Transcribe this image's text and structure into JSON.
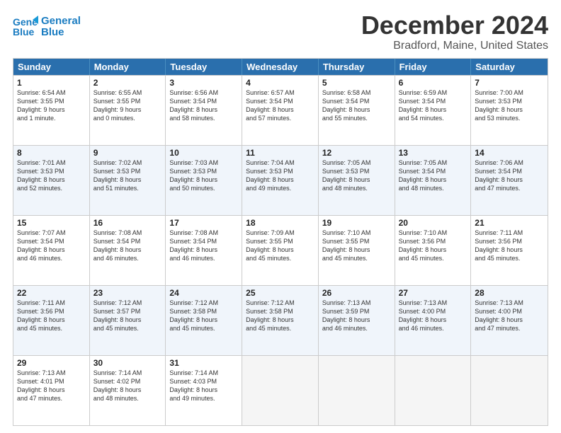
{
  "header": {
    "logo_line1": "General",
    "logo_line2": "Blue",
    "title": "December 2024",
    "subtitle": "Bradford, Maine, United States"
  },
  "calendar": {
    "weekdays": [
      "Sunday",
      "Monday",
      "Tuesday",
      "Wednesday",
      "Thursday",
      "Friday",
      "Saturday"
    ],
    "rows": [
      [
        {
          "day": "1",
          "lines": [
            "Sunrise: 6:54 AM",
            "Sunset: 3:55 PM",
            "Daylight: 9 hours",
            "and 1 minute."
          ]
        },
        {
          "day": "2",
          "lines": [
            "Sunrise: 6:55 AM",
            "Sunset: 3:55 PM",
            "Daylight: 9 hours",
            "and 0 minutes."
          ]
        },
        {
          "day": "3",
          "lines": [
            "Sunrise: 6:56 AM",
            "Sunset: 3:54 PM",
            "Daylight: 8 hours",
            "and 58 minutes."
          ]
        },
        {
          "day": "4",
          "lines": [
            "Sunrise: 6:57 AM",
            "Sunset: 3:54 PM",
            "Daylight: 8 hours",
            "and 57 minutes."
          ]
        },
        {
          "day": "5",
          "lines": [
            "Sunrise: 6:58 AM",
            "Sunset: 3:54 PM",
            "Daylight: 8 hours",
            "and 55 minutes."
          ]
        },
        {
          "day": "6",
          "lines": [
            "Sunrise: 6:59 AM",
            "Sunset: 3:54 PM",
            "Daylight: 8 hours",
            "and 54 minutes."
          ]
        },
        {
          "day": "7",
          "lines": [
            "Sunrise: 7:00 AM",
            "Sunset: 3:53 PM",
            "Daylight: 8 hours",
            "and 53 minutes."
          ]
        }
      ],
      [
        {
          "day": "8",
          "lines": [
            "Sunrise: 7:01 AM",
            "Sunset: 3:53 PM",
            "Daylight: 8 hours",
            "and 52 minutes."
          ]
        },
        {
          "day": "9",
          "lines": [
            "Sunrise: 7:02 AM",
            "Sunset: 3:53 PM",
            "Daylight: 8 hours",
            "and 51 minutes."
          ]
        },
        {
          "day": "10",
          "lines": [
            "Sunrise: 7:03 AM",
            "Sunset: 3:53 PM",
            "Daylight: 8 hours",
            "and 50 minutes."
          ]
        },
        {
          "day": "11",
          "lines": [
            "Sunrise: 7:04 AM",
            "Sunset: 3:53 PM",
            "Daylight: 8 hours",
            "and 49 minutes."
          ]
        },
        {
          "day": "12",
          "lines": [
            "Sunrise: 7:05 AM",
            "Sunset: 3:53 PM",
            "Daylight: 8 hours",
            "and 48 minutes."
          ]
        },
        {
          "day": "13",
          "lines": [
            "Sunrise: 7:05 AM",
            "Sunset: 3:54 PM",
            "Daylight: 8 hours",
            "and 48 minutes."
          ]
        },
        {
          "day": "14",
          "lines": [
            "Sunrise: 7:06 AM",
            "Sunset: 3:54 PM",
            "Daylight: 8 hours",
            "and 47 minutes."
          ]
        }
      ],
      [
        {
          "day": "15",
          "lines": [
            "Sunrise: 7:07 AM",
            "Sunset: 3:54 PM",
            "Daylight: 8 hours",
            "and 46 minutes."
          ]
        },
        {
          "day": "16",
          "lines": [
            "Sunrise: 7:08 AM",
            "Sunset: 3:54 PM",
            "Daylight: 8 hours",
            "and 46 minutes."
          ]
        },
        {
          "day": "17",
          "lines": [
            "Sunrise: 7:08 AM",
            "Sunset: 3:54 PM",
            "Daylight: 8 hours",
            "and 46 minutes."
          ]
        },
        {
          "day": "18",
          "lines": [
            "Sunrise: 7:09 AM",
            "Sunset: 3:55 PM",
            "Daylight: 8 hours",
            "and 45 minutes."
          ]
        },
        {
          "day": "19",
          "lines": [
            "Sunrise: 7:10 AM",
            "Sunset: 3:55 PM",
            "Daylight: 8 hours",
            "and 45 minutes."
          ]
        },
        {
          "day": "20",
          "lines": [
            "Sunrise: 7:10 AM",
            "Sunset: 3:56 PM",
            "Daylight: 8 hours",
            "and 45 minutes."
          ]
        },
        {
          "day": "21",
          "lines": [
            "Sunrise: 7:11 AM",
            "Sunset: 3:56 PM",
            "Daylight: 8 hours",
            "and 45 minutes."
          ]
        }
      ],
      [
        {
          "day": "22",
          "lines": [
            "Sunrise: 7:11 AM",
            "Sunset: 3:56 PM",
            "Daylight: 8 hours",
            "and 45 minutes."
          ]
        },
        {
          "day": "23",
          "lines": [
            "Sunrise: 7:12 AM",
            "Sunset: 3:57 PM",
            "Daylight: 8 hours",
            "and 45 minutes."
          ]
        },
        {
          "day": "24",
          "lines": [
            "Sunrise: 7:12 AM",
            "Sunset: 3:58 PM",
            "Daylight: 8 hours",
            "and 45 minutes."
          ]
        },
        {
          "day": "25",
          "lines": [
            "Sunrise: 7:12 AM",
            "Sunset: 3:58 PM",
            "Daylight: 8 hours",
            "and 45 minutes."
          ]
        },
        {
          "day": "26",
          "lines": [
            "Sunrise: 7:13 AM",
            "Sunset: 3:59 PM",
            "Daylight: 8 hours",
            "and 46 minutes."
          ]
        },
        {
          "day": "27",
          "lines": [
            "Sunrise: 7:13 AM",
            "Sunset: 4:00 PM",
            "Daylight: 8 hours",
            "and 46 minutes."
          ]
        },
        {
          "day": "28",
          "lines": [
            "Sunrise: 7:13 AM",
            "Sunset: 4:00 PM",
            "Daylight: 8 hours",
            "and 47 minutes."
          ]
        }
      ],
      [
        {
          "day": "29",
          "lines": [
            "Sunrise: 7:13 AM",
            "Sunset: 4:01 PM",
            "Daylight: 8 hours",
            "and 47 minutes."
          ]
        },
        {
          "day": "30",
          "lines": [
            "Sunrise: 7:14 AM",
            "Sunset: 4:02 PM",
            "Daylight: 8 hours",
            "and 48 minutes."
          ]
        },
        {
          "day": "31",
          "lines": [
            "Sunrise: 7:14 AM",
            "Sunset: 4:03 PM",
            "Daylight: 8 hours",
            "and 49 minutes."
          ]
        },
        {
          "day": "",
          "lines": []
        },
        {
          "day": "",
          "lines": []
        },
        {
          "day": "",
          "lines": []
        },
        {
          "day": "",
          "lines": []
        }
      ]
    ]
  }
}
